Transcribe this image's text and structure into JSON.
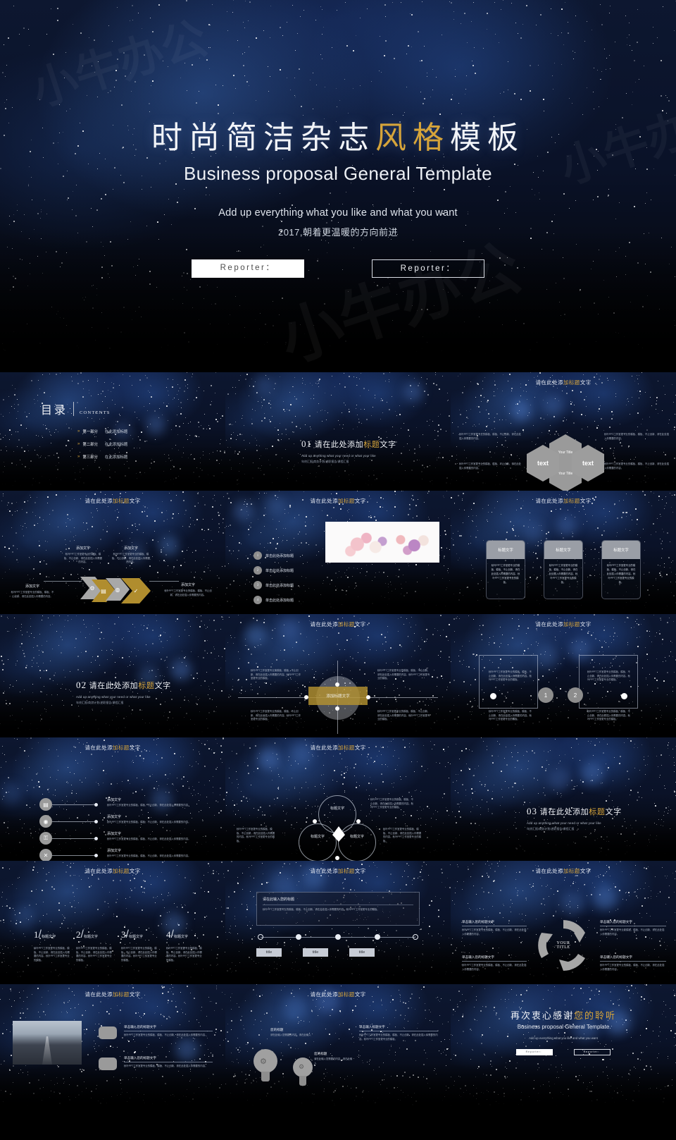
{
  "hero": {
    "title_plain_1": "时尚简洁杂志",
    "title_gold": "风格",
    "title_plain_2": "模板",
    "subtitle": "Business proposal General Template",
    "line1": "Add up everything what you like and what you want",
    "line2": "2017,朝着更温暖的方向前进",
    "button_left": "Reporter：",
    "button_right": "Reporter："
  },
  "watermark": "小牛办公",
  "common": {
    "slide_title_prefix": "请在此处添",
    "slide_title_gold": "加标题",
    "slide_title_suffix": "文字",
    "body_text": "秋叶PPT工作室更专业的模板、模板、不止创新、请在此处插入你需要的内容。秋叶PPT工作室更专业的模板。",
    "body_text_short": "秋叶PPT工作室更专业的模板、模板、不止创新、请在此处插入你需要的内容。",
    "add_text": "添加文字",
    "title_text": "标题文字",
    "add_title_text": "添加标题文字",
    "click_add_title": "单击此处添加标题",
    "input_your_title": "单击输入您的标题文字"
  },
  "slides": {
    "contents": {
      "heading_cn": "目录",
      "heading_en": "CONTENTS",
      "items": [
        {
          "part": "第一部分",
          "label": "在此添加标题"
        },
        {
          "part": "第二部分",
          "label": "在此添加标题"
        },
        {
          "part": "第三部分",
          "label": "在此添加标题"
        }
      ]
    },
    "section01": {
      "number": "01",
      "title_plain": "请在此处添加",
      "title_gold": "标题",
      "title_suffix": "文字",
      "sub_en": "Add up anything what your need or what your like",
      "sub_cn": "年终汇报/商务计划/述职报告/课程汇报"
    },
    "section02": {
      "number": "02",
      "title_plain": "请在此处添加",
      "title_gold": "标题",
      "title_suffix": "文字",
      "sub_en": "Add up anything what your need or what your like",
      "sub_cn": "年终汇报/商务计划/述职报告/课程汇报"
    },
    "section03": {
      "number": "03",
      "title_plain": "请在此处添加",
      "title_gold": "标题",
      "title_suffix": "文字",
      "sub_en": "Add up anything what your need or what your like",
      "sub_cn": "年终汇报/商务计划/述职报告/课程汇报"
    },
    "hexagons": {
      "hex_top": "Your Title",
      "hex_bottom": "Your Title",
      "hex_left": "text",
      "hex_right": "text"
    },
    "chevrons": {
      "label": "添加文字"
    },
    "numbered_image": {
      "items": [
        "单击此处添加标题",
        "单击此处添加标题",
        "单击此处添加标题",
        "单击此处添加标题"
      ],
      "numbers": [
        "1",
        "2",
        "3",
        "4"
      ]
    },
    "three_cards": {
      "headers": [
        "标题文字",
        "标题文字",
        "标题文字"
      ]
    },
    "gold_cross": {
      "center_label": "添加标题文字"
    },
    "two_brackets": {
      "numbers": [
        "1",
        "2"
      ]
    },
    "icon_list": {
      "icons": [
        "briefcase-icon",
        "coins-icon",
        "key-icon",
        "tools-icon"
      ],
      "glyphs": [
        "▤",
        "◉",
        "⚿",
        "✕"
      ],
      "labels": [
        "添加文字",
        "添加文字",
        "添加文字",
        "添加文字"
      ]
    },
    "venn": {
      "labels": [
        "标题文字",
        "标题文字",
        "标题文字"
      ]
    },
    "four_numbers": {
      "numbers": [
        "1",
        "2",
        "3",
        "4"
      ],
      "labels": [
        "标题文字",
        "标题文字",
        "标题文字",
        "标题文字"
      ]
    },
    "panel_timeline": {
      "panel_heading": "请在此输入您的标题",
      "boxes": [
        "title",
        "title",
        "title"
      ]
    },
    "cycle": {
      "center_line1": "YOUR",
      "center_line2": "TITLE",
      "side_headings": [
        "单击输入您的标题文字",
        "单击输入您的标题文字",
        "单击输入您的标题文字",
        "单击输入您的标题文字"
      ]
    },
    "road_bubbles": {
      "headings": [
        "单击输入您的标题文字",
        "单击输入您的标题文字"
      ]
    },
    "bulbs": {
      "label1": "您的标题",
      "label2": "您的标题",
      "body": "请在此输入您需要的内容，请在此输入",
      "side_heading": "单击输入标题文字"
    },
    "thanks": {
      "title_plain": "再次衷心感谢",
      "title_gold": "您的聆听",
      "subtitle": "Business proposal General Template",
      "line": "Add up everything what you like and what you want",
      "button_left": "Reporter：",
      "button_right": "Reporter："
    }
  },
  "colors": {
    "gold": "#d6a43a",
    "bg_dark": "#000000",
    "sky_blue": "#0d1730"
  }
}
